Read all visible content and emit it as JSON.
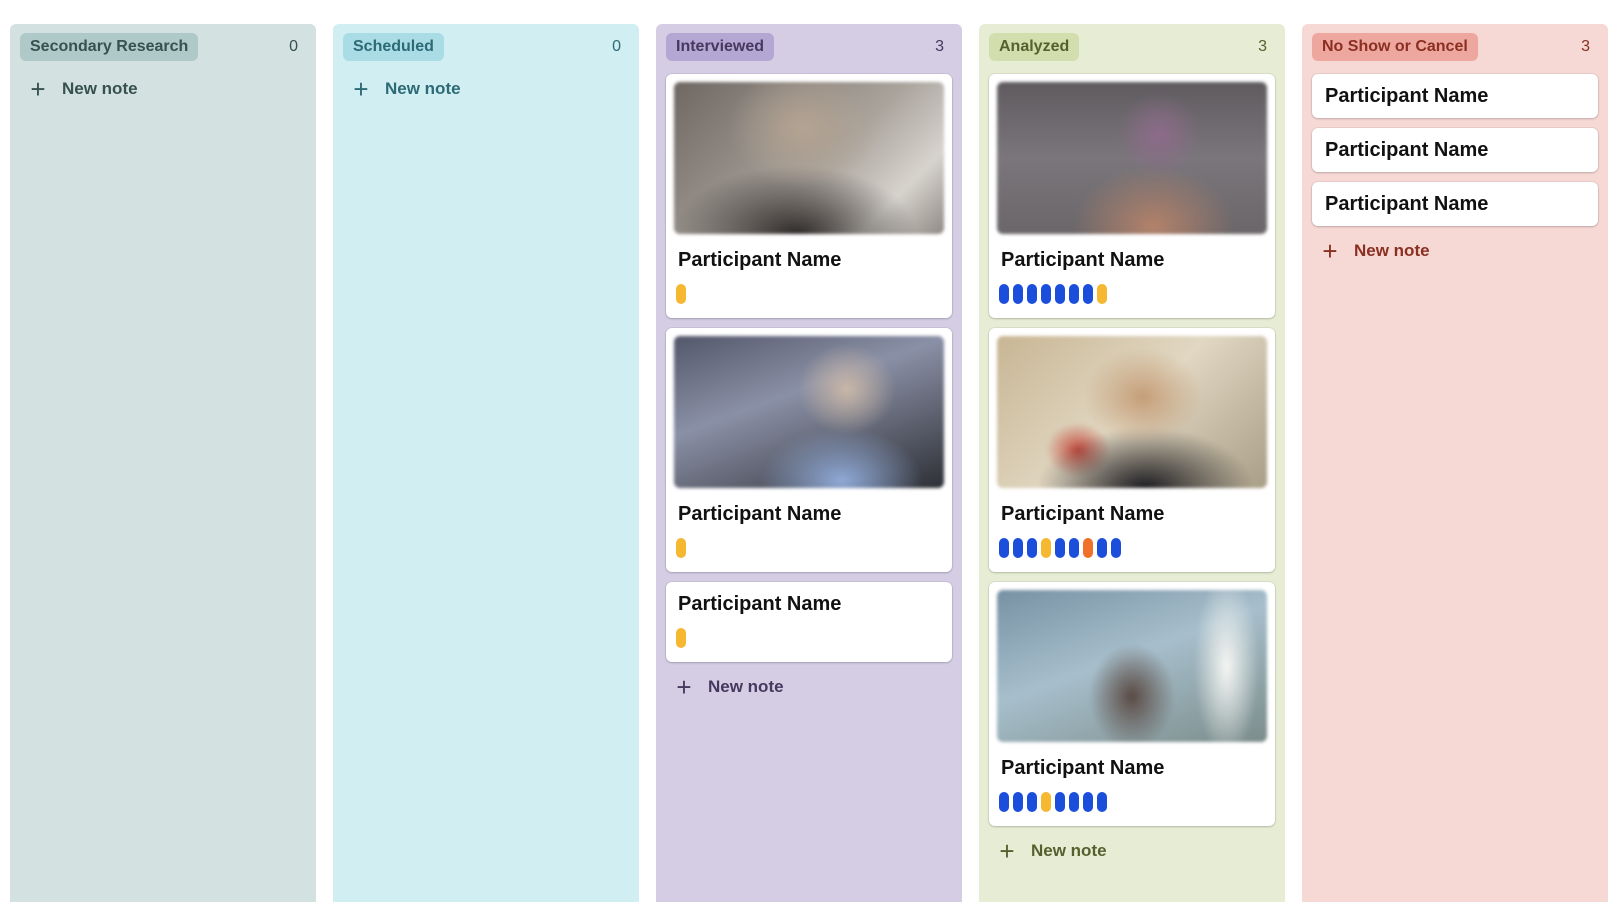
{
  "board": {
    "columns": [
      {
        "title": "Secondary Research",
        "count": "0",
        "colors": {
          "bg": "#d3e1e0",
          "pill": "#aec9c7",
          "text": "#36514f"
        },
        "new_note": "New note",
        "cards": []
      },
      {
        "title": "Scheduled",
        "count": "0",
        "colors": {
          "bg": "#d1eef2",
          "pill": "#a9dce5",
          "text": "#2c6a76"
        },
        "new_note": "New note",
        "cards": []
      },
      {
        "title": "Interviewed",
        "count": "3",
        "colors": {
          "bg": "#d4cde4",
          "pill": "#b5a7d3",
          "text": "#45395f"
        },
        "new_note": "New note",
        "cards": [
          {
            "name": "Participant Name",
            "has_image": true,
            "image_theme": "blurred-video-room",
            "tags": [
              "yellow"
            ]
          },
          {
            "name": "Participant Name",
            "has_image": true,
            "image_theme": "blurred-video-blue",
            "tags": [
              "yellow"
            ]
          },
          {
            "name": "Participant Name",
            "has_image": false,
            "tags": [
              "yellow"
            ]
          }
        ]
      },
      {
        "title": "Analyzed",
        "count": "3",
        "colors": {
          "bg": "#e7edd5",
          "pill": "#d3deaf",
          "text": "#56602e"
        },
        "new_note": "New note",
        "cards": [
          {
            "name": "Participant Name",
            "has_image": true,
            "image_theme": "blurred-video-dark",
            "tags": [
              "blue",
              "blue",
              "blue",
              "blue",
              "blue",
              "blue",
              "blue",
              "yellow"
            ]
          },
          {
            "name": "Participant Name",
            "has_image": true,
            "image_theme": "blurred-video-warm",
            "tags": [
              "blue",
              "blue",
              "blue",
              "yellow",
              "blue",
              "blue",
              "orange",
              "blue",
              "blue"
            ]
          },
          {
            "name": "Participant Name",
            "has_image": true,
            "image_theme": "blurred-video-window",
            "tags": [
              "blue",
              "blue",
              "blue",
              "yellow",
              "blue",
              "blue",
              "blue",
              "blue"
            ]
          }
        ]
      },
      {
        "title": "No Show or Cancel",
        "count": "3",
        "colors": {
          "bg": "#f6d8d4",
          "pill": "#eda79f",
          "text": "#8a2f22"
        },
        "new_note": "New note",
        "cards": [
          {
            "name": "Participant Name",
            "has_image": false,
            "tags": []
          },
          {
            "name": "Participant Name",
            "has_image": false,
            "tags": []
          },
          {
            "name": "Participant Name",
            "has_image": false,
            "tags": []
          }
        ]
      }
    ],
    "tag_colors": {
      "blue": "#1b4fdb",
      "yellow": "#f6b731",
      "orange": "#f2712a"
    }
  }
}
